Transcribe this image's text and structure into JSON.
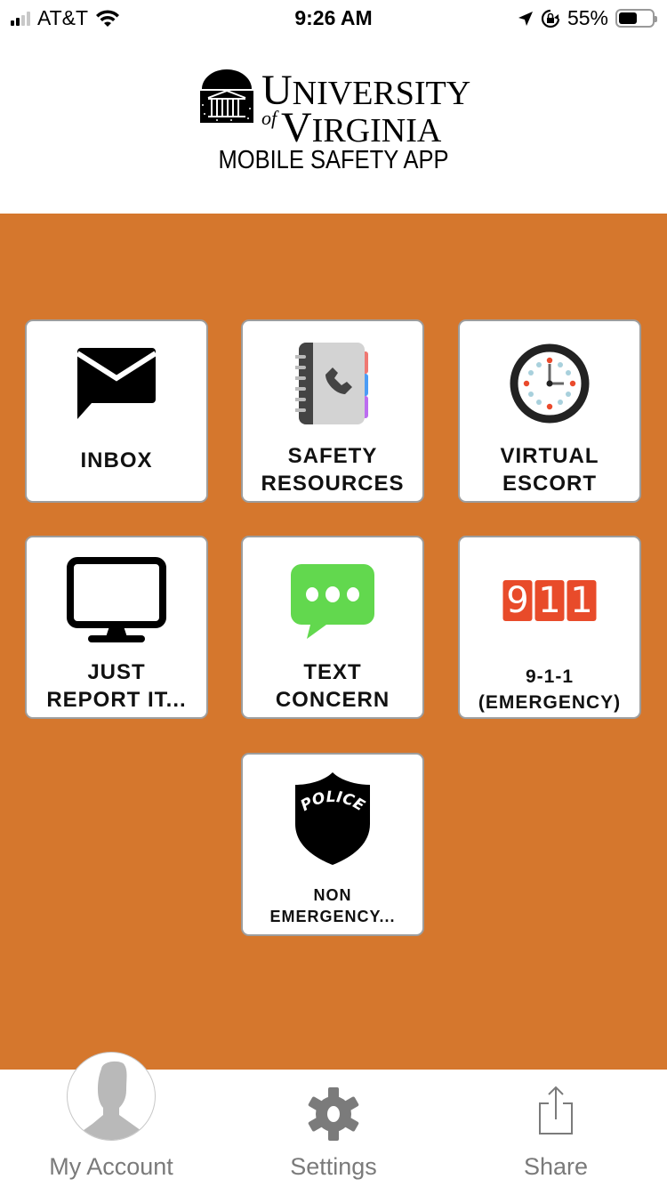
{
  "status_bar": {
    "carrier": "AT&T",
    "time": "9:26 AM",
    "battery_percent_text": "55%",
    "battery_level": 0.55,
    "icons": [
      "signal-icon",
      "wifi-icon",
      "location-arrow-icon",
      "orientation-lock-icon",
      "battery-icon"
    ]
  },
  "header": {
    "logo_line1_first": "U",
    "logo_line1_rest": "NIVERSITY",
    "logo_of": "of",
    "logo_line2_first": "V",
    "logo_line2_rest": "IRGINIA",
    "app_title": "MOBILE SAFETY APP"
  },
  "colors": {
    "background_orange": "#d5772d",
    "tile_border": "#9d9d9d",
    "text_concern_green": "#62d84e",
    "emergency_red": "#e84b2a",
    "tab_gray": "#7a7a7a"
  },
  "tiles": [
    {
      "id": "inbox",
      "icon": "envelope-chat-icon",
      "lines": [
        "INBOX"
      ]
    },
    {
      "id": "safety-resources",
      "icon": "address-book-phone-icon",
      "lines": [
        "SAFETY",
        "RESOURCES"
      ]
    },
    {
      "id": "virtual-escort",
      "icon": "clock-icon",
      "lines": [
        "VIRTUAL",
        "ESCORT"
      ]
    },
    {
      "id": "just-report-it",
      "icon": "monitor-icon",
      "lines": [
        "JUST",
        "REPORT IT..."
      ]
    },
    {
      "id": "text-concern",
      "icon": "speech-bubble-icon",
      "lines": [
        "TEXT",
        "CONCERN"
      ]
    },
    {
      "id": "emergency-911",
      "icon": "911-icon",
      "digits": [
        "9",
        "1",
        "1"
      ],
      "lines": [
        "9-1-1",
        "(EMERGENCY)"
      ]
    },
    {
      "id": "non-emergency",
      "icon": "police-badge-icon",
      "badge_text": "POLICE",
      "lines": [
        "NON",
        "EMERGENCY..."
      ]
    }
  ],
  "tabbar": {
    "items": [
      {
        "label": "My Account",
        "icon": "avatar-icon"
      },
      {
        "label": "Settings",
        "icon": "gear-icon"
      },
      {
        "label": "Share",
        "icon": "share-icon"
      }
    ]
  }
}
